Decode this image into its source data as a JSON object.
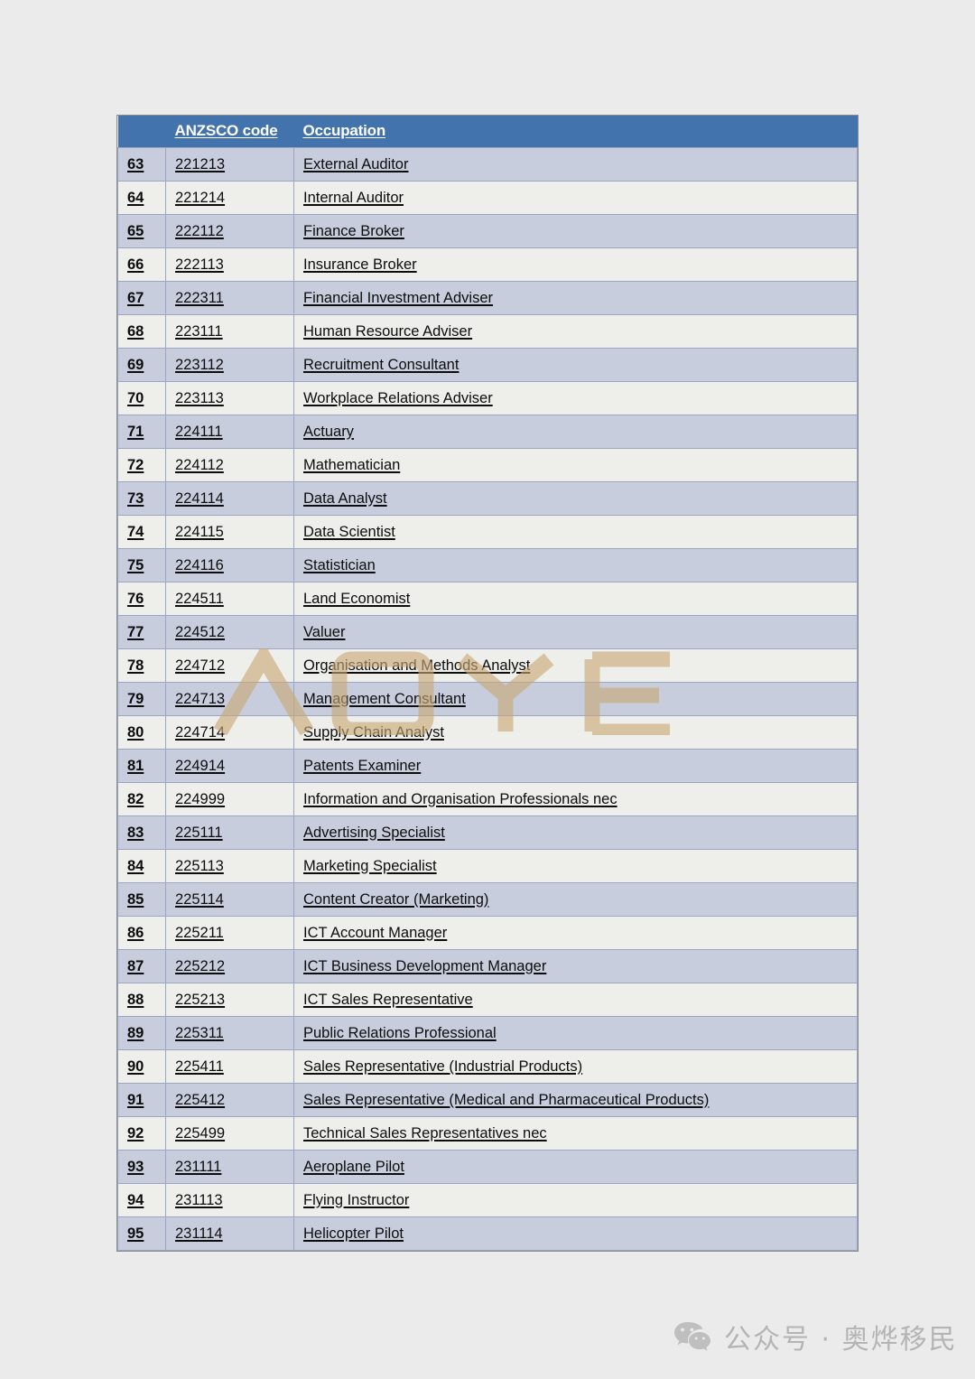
{
  "page": {
    "background_color": "#ebebeb",
    "watermark_text": "AOYE",
    "watermark_color": "#c9a875"
  },
  "table": {
    "header_bg": "#4373ad",
    "row_odd_bg": "#c7cddd",
    "row_even_bg": "#eeeeea",
    "columns": [
      "",
      "ANZSCO code",
      "Occupation"
    ],
    "rows": [
      {
        "index": "63",
        "code": "221213",
        "occupation": "External Auditor"
      },
      {
        "index": "64",
        "code": "221214",
        "occupation": "Internal Auditor"
      },
      {
        "index": "65",
        "code": "222112",
        "occupation": "Finance Broker"
      },
      {
        "index": "66",
        "code": "222113",
        "occupation": "Insurance Broker"
      },
      {
        "index": "67",
        "code": "222311",
        "occupation": "Financial Investment Adviser"
      },
      {
        "index": "68",
        "code": "223111",
        "occupation": "Human Resource Adviser"
      },
      {
        "index": "69",
        "code": "223112",
        "occupation": "Recruitment Consultant"
      },
      {
        "index": "70",
        "code": "223113",
        "occupation": "Workplace Relations Adviser"
      },
      {
        "index": "71",
        "code": "224111",
        "occupation": "Actuary"
      },
      {
        "index": "72",
        "code": "224112",
        "occupation": "Mathematician"
      },
      {
        "index": "73",
        "code": "224114",
        "occupation": "Data Analyst"
      },
      {
        "index": "74",
        "code": "224115",
        "occupation": "Data Scientist"
      },
      {
        "index": "75",
        "code": "224116",
        "occupation": "Statistician"
      },
      {
        "index": "76",
        "code": "224511",
        "occupation": "Land Economist"
      },
      {
        "index": "77",
        "code": "224512",
        "occupation": "Valuer"
      },
      {
        "index": "78",
        "code": "224712",
        "occupation": "Organisation and Methods Analyst"
      },
      {
        "index": "79",
        "code": "224713",
        "occupation": "Management Consultant"
      },
      {
        "index": "80",
        "code": "224714",
        "occupation": "Supply Chain Analyst"
      },
      {
        "index": "81",
        "code": "224914",
        "occupation": "Patents Examiner"
      },
      {
        "index": "82",
        "code": "224999",
        "occupation": "Information and Organisation Professionals nec"
      },
      {
        "index": "83",
        "code": "225111",
        "occupation": "Advertising Specialist"
      },
      {
        "index": "84",
        "code": "225113",
        "occupation": "Marketing Specialist"
      },
      {
        "index": "85",
        "code": "225114",
        "occupation": "Content Creator (Marketing)"
      },
      {
        "index": "86",
        "code": "225211",
        "occupation": "ICT Account Manager"
      },
      {
        "index": "87",
        "code": "225212",
        "occupation": "ICT Business Development Manager"
      },
      {
        "index": "88",
        "code": "225213",
        "occupation": "ICT Sales Representative"
      },
      {
        "index": "89",
        "code": "225311",
        "occupation": "Public Relations Professional"
      },
      {
        "index": "90",
        "code": "225411",
        "occupation": "Sales Representative (Industrial Products)"
      },
      {
        "index": "91",
        "code": "225412",
        "occupation": "Sales Representative (Medical and Pharmaceutical Products)"
      },
      {
        "index": "92",
        "code": "225499",
        "occupation": "Technical Sales Representatives nec"
      },
      {
        "index": "93",
        "code": "231111",
        "occupation": "Aeroplane Pilot"
      },
      {
        "index": "94",
        "code": "231113",
        "occupation": "Flying Instructor"
      },
      {
        "index": "95",
        "code": "231114",
        "occupation": "Helicopter Pilot"
      }
    ]
  },
  "footer": {
    "icon": "wechat-icon",
    "text": "公众号 · 奥烨移民",
    "text_color": "#b4b4b4"
  }
}
